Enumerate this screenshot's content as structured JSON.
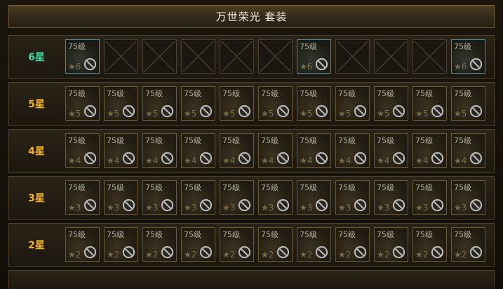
{
  "title": "万世荣光 套装",
  "colors": {
    "six_star": "#3fd6a4",
    "other_star": "#f0b22a"
  },
  "rows": [
    {
      "label": "6星",
      "color": "six_star",
      "slots": [
        {
          "type": "item",
          "level": "75级",
          "grade": "6"
        },
        {
          "type": "empty"
        },
        {
          "type": "empty"
        },
        {
          "type": "empty"
        },
        {
          "type": "empty"
        },
        {
          "type": "empty"
        },
        {
          "type": "item",
          "level": "75级",
          "grade": "6"
        },
        {
          "type": "empty"
        },
        {
          "type": "empty"
        },
        {
          "type": "empty"
        },
        {
          "type": "item",
          "level": "75级",
          "grade": "6"
        }
      ]
    },
    {
      "label": "5星",
      "color": "other_star",
      "grade": "5",
      "count": 11,
      "level": "75级"
    },
    {
      "label": "4星",
      "color": "other_star",
      "grade": "4",
      "count": 11,
      "level": "75级"
    },
    {
      "label": "3星",
      "color": "other_star",
      "grade": "3",
      "count": 11,
      "level": "75级"
    },
    {
      "label": "2星",
      "color": "other_star",
      "grade": "2",
      "count": 11,
      "level": "75级"
    }
  ],
  "icons": {
    "ban": "ban-icon",
    "star": "star-icon",
    "empty": "empty-slot-x"
  }
}
